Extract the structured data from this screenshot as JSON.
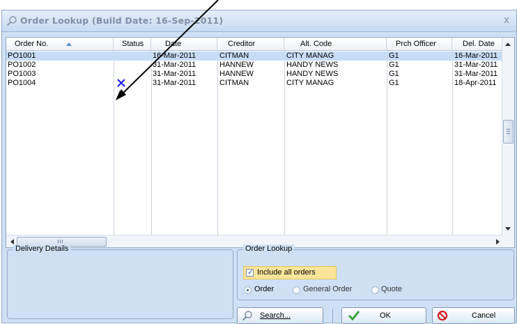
{
  "window": {
    "title": "Order Lookup (Build Date: 16-Sep-2011)",
    "close_glyph": "x"
  },
  "grid": {
    "columns": [
      "Order No.",
      "Status",
      "Date",
      "Creditor",
      "Alt. Code",
      "Prch Officer",
      "Del. Date"
    ],
    "sorted_column": "Order No.",
    "rows": [
      {
        "order_no": "PO1001",
        "status": "",
        "date": "16-Mar-2011",
        "creditor": "CITMAN",
        "alt_code": "CITY MANAG",
        "prch_officer": "G1",
        "del_date": "16-Mar-2011",
        "selected": true
      },
      {
        "order_no": "PO1002",
        "status": "",
        "date": "31-Mar-2011",
        "creditor": "HANNEW",
        "alt_code": "HANDY NEWS",
        "prch_officer": "G1",
        "del_date": "31-Mar-2011",
        "selected": false
      },
      {
        "order_no": "PO1003",
        "status": "",
        "date": "31-Mar-2011",
        "creditor": "HANNEW",
        "alt_code": "HANDY NEWS",
        "prch_officer": "G1",
        "del_date": "31-Mar-2011",
        "selected": false
      },
      {
        "order_no": "PO1004",
        "status": "cross-icon",
        "date": "31-Mar-2011",
        "creditor": "CITMAN",
        "alt_code": "CITY MANAG",
        "prch_officer": "G1",
        "del_date": "18-Apr-2011",
        "selected": false
      }
    ],
    "status_icon_color": "#1a1aff"
  },
  "delivery_details": {
    "label": "Delivery Details"
  },
  "order_lookup": {
    "label": "Order Lookup",
    "include_all_label": "Include all orders",
    "include_all_checked": true,
    "radios": [
      {
        "label": "Order",
        "checked": true
      },
      {
        "label": "General Order",
        "checked": false
      },
      {
        "label": "Quote",
        "checked": false
      }
    ]
  },
  "buttons": {
    "search": "Search...",
    "ok": "OK",
    "cancel": "Cancel"
  },
  "colors": {
    "window_bg": "#cfe0f4",
    "selected_row": "#c7ddf6",
    "checkbox_highlight": "#fbe59a",
    "ok_check": "#3aa53a",
    "cancel_icon": "#d21c1c"
  }
}
